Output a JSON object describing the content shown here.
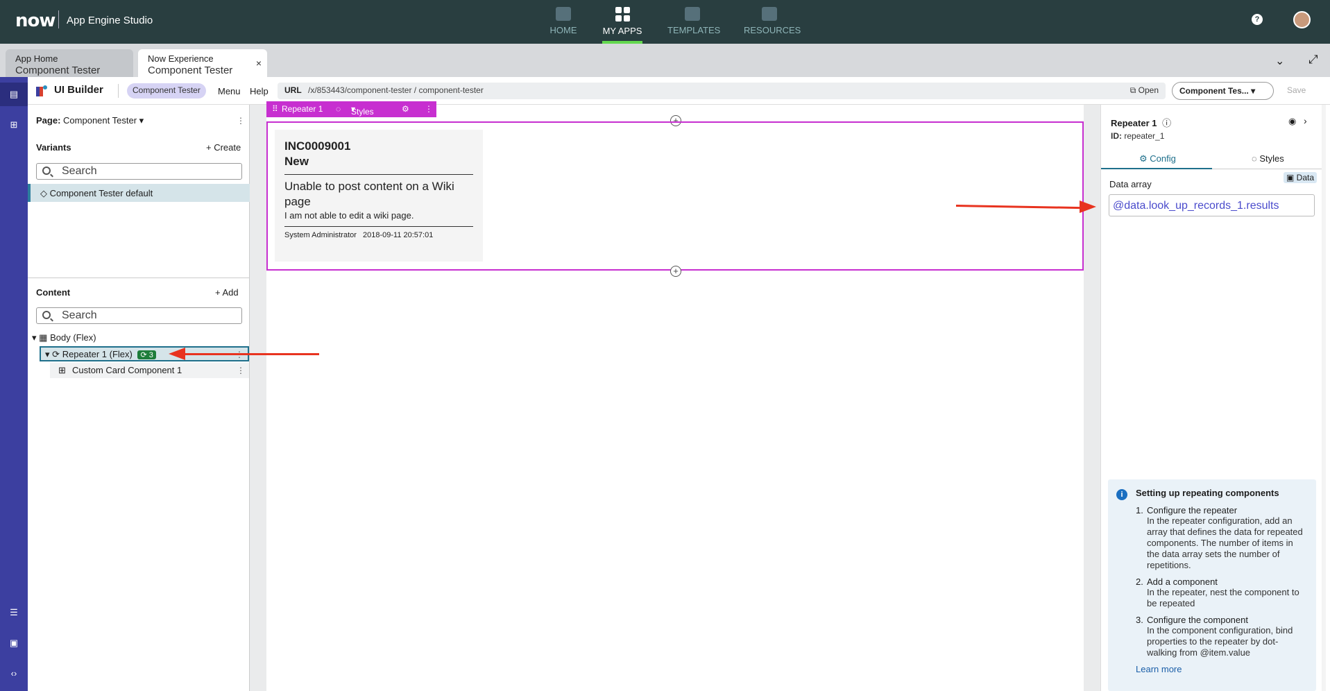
{
  "topbar": {
    "logo": "now",
    "app_name": "App Engine Studio",
    "nav": [
      {
        "label": "HOME",
        "icon": "home-icon"
      },
      {
        "label": "MY APPS",
        "icon": "grid-icon"
      },
      {
        "label": "TEMPLATES",
        "icon": "templates-icon"
      },
      {
        "label": "RESOURCES",
        "icon": "resources-icon"
      }
    ],
    "help": "?"
  },
  "tabs": [
    {
      "line1": "App Home",
      "line2": "Component Tester"
    },
    {
      "line1": "Now Experience",
      "line2": "Component Tester",
      "close": "×"
    }
  ],
  "uibuilder": {
    "title": "UI Builder",
    "pill": "Component Tester",
    "menu": "Menu",
    "help": "Help",
    "url_label": "URL",
    "url": "/x/853443/component-tester / component-tester",
    "open": "Open",
    "experience_select": "Component Tes...",
    "save": "Save"
  },
  "left": {
    "page_label": "Page:",
    "page_value": "Component Tester",
    "variants_label": "Variants",
    "create": "+ Create",
    "search_placeholder": "Search",
    "variant_item": "◇ Component Tester default",
    "content_label": "Content",
    "add": "+ Add",
    "tree": {
      "body": "Body (Flex)",
      "repeater": "Repeater 1 (Flex)",
      "repeater_count": "3",
      "child": "Custom Card Component 1"
    }
  },
  "toolbar": {
    "name": "Repeater 1",
    "styles": "Styles"
  },
  "card": {
    "number": "INC0009001",
    "state": "New",
    "title": "Unable to post content on a Wiki page",
    "description": "I am not able to edit a wiki page.",
    "author": "System Administrator",
    "date": "2018-09-11 20:57:01"
  },
  "right": {
    "title": "Repeater 1",
    "id_label": "ID:",
    "id_value": "repeater_1",
    "tab_config": "Config",
    "tab_styles": "Styles",
    "data_chip": "Data",
    "data_array_label": "Data array",
    "data_array_value": "@data.look_up_records_1.results",
    "info": {
      "heading": "Setting up repeating components",
      "steps": [
        {
          "n": "1.",
          "head": "Configure the repeater",
          "body": "In the repeater configuration, add an array that defines the data for repeated components. The number of items in the data array sets the number of repetitions."
        },
        {
          "n": "2.",
          "head": "Add a component",
          "body": "In the repeater, nest the component to be repeated"
        },
        {
          "n": "3.",
          "head": "Configure the component",
          "body": "In the component configuration, bind properties to the repeater by dot-walking from @item.value"
        }
      ],
      "learn_more": "Learn more"
    }
  },
  "colors": {
    "topbar": "#293e40",
    "accent_green": "#62d84e",
    "rail": "#3c3fa0",
    "selection": "#c72fd0",
    "annotation_arrow": "#e8331f"
  }
}
